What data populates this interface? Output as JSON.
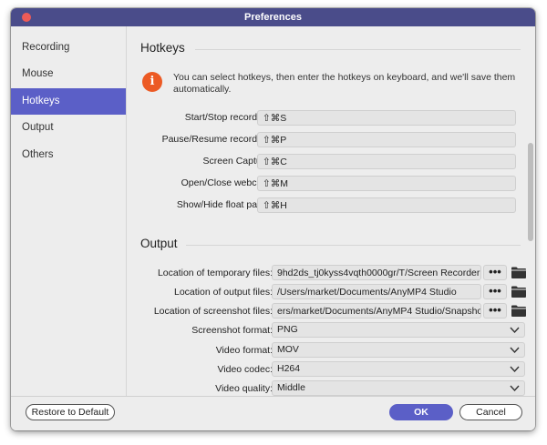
{
  "window": {
    "title": "Preferences"
  },
  "sidebar": {
    "items": [
      {
        "label": "Recording",
        "active": false
      },
      {
        "label": "Mouse",
        "active": false
      },
      {
        "label": "Hotkeys",
        "active": true
      },
      {
        "label": "Output",
        "active": false
      },
      {
        "label": "Others",
        "active": false
      }
    ]
  },
  "hotkeys": {
    "title": "Hotkeys",
    "info_icon": "info-icon",
    "info_text": "You can select hotkeys, then enter the hotkeys on keyboard, and we'll save them automatically.",
    "rows": [
      {
        "label": "Start/Stop recording:",
        "value": "⇧⌘S"
      },
      {
        "label": "Pause/Resume recording:",
        "value": "⇧⌘P"
      },
      {
        "label": "Screen Capture:",
        "value": "⇧⌘C"
      },
      {
        "label": "Open/Close webcam:",
        "value": "⇧⌘M"
      },
      {
        "label": "Show/Hide float panel:",
        "value": "⇧⌘H"
      }
    ]
  },
  "output": {
    "title": "Output",
    "paths": [
      {
        "label": "Location of temporary files:",
        "value": "9hd2ds_tj0kyss4vqth0000gr/T/Screen Recorder",
        "browse": "•••"
      },
      {
        "label": "Location of output files:",
        "value": "/Users/market/Documents/AnyMP4 Studio",
        "browse": "•••"
      },
      {
        "label": "Location of screenshot files:",
        "value": "ers/market/Documents/AnyMP4 Studio/Snapshot",
        "browse": "•••"
      }
    ],
    "selects": [
      {
        "label": "Screenshot format:",
        "value": "PNG"
      },
      {
        "label": "Video format:",
        "value": "MOV"
      },
      {
        "label": "Video codec:",
        "value": "H264"
      },
      {
        "label": "Video quality:",
        "value": "Middle"
      }
    ]
  },
  "footer": {
    "restore_label": "Restore to Default",
    "ok_label": "OK",
    "cancel_label": "Cancel"
  },
  "colors": {
    "titlebar": "#4a4c8a",
    "accent": "#5b5fc7",
    "info": "#ec5a24",
    "close": "#ee5b57"
  }
}
